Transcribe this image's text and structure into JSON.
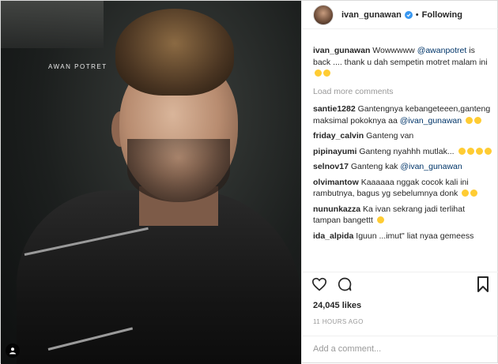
{
  "photo": {
    "watermark": "AWAN POTRET"
  },
  "header": {
    "username": "ivan_gunawan",
    "separator": "•",
    "follow_status": "Following"
  },
  "caption": {
    "username": "ivan_gunawan",
    "text_before": "Wowwwww",
    "mention": "@awanpotret",
    "text_after": "is back .... thank u dah sempetin motret malam ini"
  },
  "load_more": "Load more comments",
  "comments": [
    {
      "user": "santie1282",
      "text": "Gantengnya kebangeteeen,ganteng maksimal pokoknya aa",
      "mention": "@ivan_gunawan"
    },
    {
      "user": "friday_calvin",
      "text": "Ganteng van"
    },
    {
      "user": "pipinayumi",
      "text": "Ganteng nyahhh mutlak..."
    },
    {
      "user": "selnov17",
      "text": "Ganteng kak",
      "mention": "@ivan_gunawan"
    },
    {
      "user": "olvimantow",
      "text": "Kaaaaaa nggak cocok kali ini rambutnya, bagus yg sebelumnya donk"
    },
    {
      "user": "nununkazza",
      "text": "Ka ivan sekrang jadi terlihat tampan bangettt"
    },
    {
      "user": "ida_alpida",
      "text": "Iguun ...imut\" liat nyaa gemeess"
    }
  ],
  "likes": "24,045 likes",
  "timestamp": "11 HOURS AGO",
  "add_comment_placeholder": "Add a comment...",
  "colors": {
    "verified": "#3897f0",
    "mention": "#003569",
    "muted": "#999999"
  }
}
